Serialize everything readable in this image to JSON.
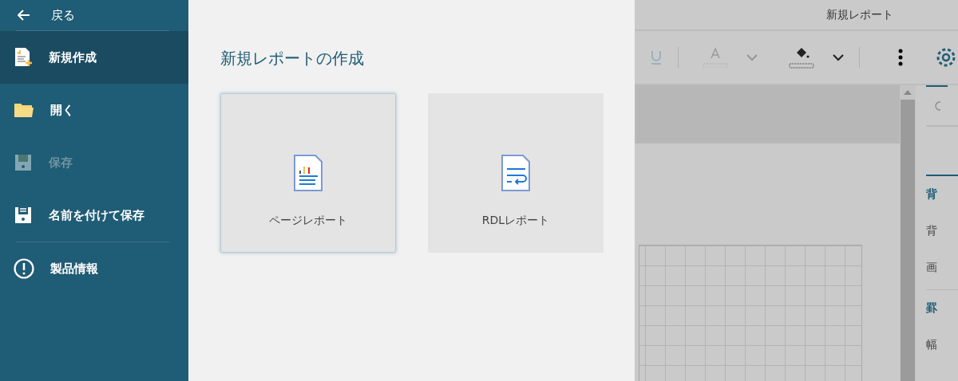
{
  "sidebar": {
    "back": {
      "label": "戻る"
    },
    "items": [
      {
        "kind": "new",
        "label": "新規作成",
        "selected": true,
        "disabled": false
      },
      {
        "kind": "open",
        "label": "開く",
        "selected": false,
        "disabled": false
      },
      {
        "kind": "save",
        "label": "保存",
        "selected": false,
        "disabled": true
      },
      {
        "kind": "saveas",
        "label": "名前を付けて保存",
        "selected": false,
        "disabled": false
      },
      {
        "kind": "about",
        "label": "製品情報",
        "selected": false,
        "disabled": false
      }
    ]
  },
  "panel": {
    "title": "新規レポートの作成",
    "cards": [
      {
        "kind": "page",
        "label": "ページレポート",
        "selected": true
      },
      {
        "kind": "rdl",
        "label": "RDLレポート",
        "selected": false
      }
    ]
  },
  "background_app": {
    "title": "新規レポート",
    "properties": [
      {
        "kind": "heading",
        "label": "背"
      },
      {
        "kind": "label",
        "label": "背"
      },
      {
        "kind": "label",
        "label": "画"
      },
      {
        "kind": "heading",
        "label": "罫"
      },
      {
        "kind": "label",
        "label": "幅"
      }
    ]
  }
}
